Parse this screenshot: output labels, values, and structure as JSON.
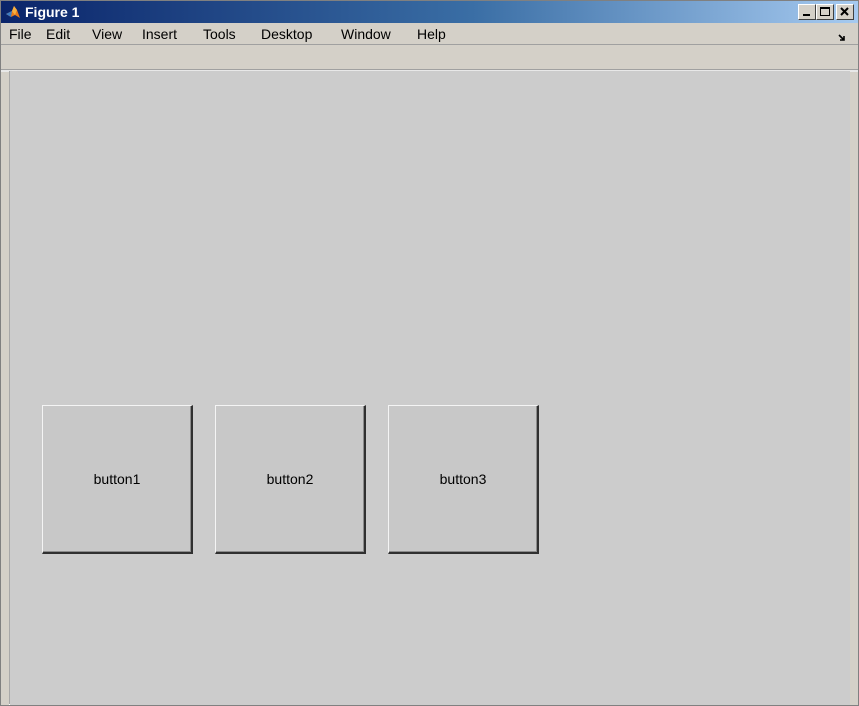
{
  "window": {
    "title": "Figure 1",
    "icon": "matlab-logo-icon",
    "controls": [
      "minimize-icon",
      "maximize-icon",
      "close-icon"
    ]
  },
  "menubar": {
    "items": [
      "File",
      "Edit",
      "View",
      "Insert",
      "Tools",
      "Desktop",
      "Window",
      "Help"
    ],
    "dock_icon": "dock-arrow-icon"
  },
  "buttons": {
    "button1": "button1",
    "button2": "button2",
    "button3": "button3"
  },
  "colors": {
    "titlebar_start": "#0a246a",
    "titlebar_end": "#a6caf0",
    "figure_background": "#cccccc",
    "button_face": "#c8c8c8"
  }
}
